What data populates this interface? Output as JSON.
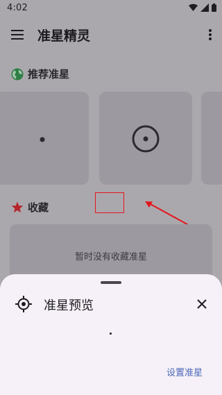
{
  "status_bar": {
    "time": "4:02",
    "icons": [
      "wifi-icon",
      "signal-icon",
      "battery-icon"
    ]
  },
  "app_bar": {
    "menu_icon": "menu-icon",
    "title": "准星精灵",
    "overflow_icon": "more-vert-icon"
  },
  "recommended": {
    "icon": "globe-icon",
    "title": "推荐准星",
    "items": [
      {
        "name": "dot-reticle"
      },
      {
        "name": "circle-dot-reticle"
      },
      {
        "name": "partial-reticle"
      }
    ]
  },
  "favorites": {
    "icon": "star-icon",
    "title": "收藏",
    "empty_message": "暂时没有收藏准星"
  },
  "annotations": {
    "highlight_color": "#e3161b",
    "arrow_color": "#e3161b"
  },
  "bottom_sheet": {
    "icon": "crosshair-icon",
    "title": "准星预览",
    "close_icon": "close-icon",
    "action_label": "设置准星"
  },
  "colors": {
    "accent": "#4b68b8",
    "recommended_icon": "#2d7f44",
    "favorites_icon": "#b4262b"
  }
}
